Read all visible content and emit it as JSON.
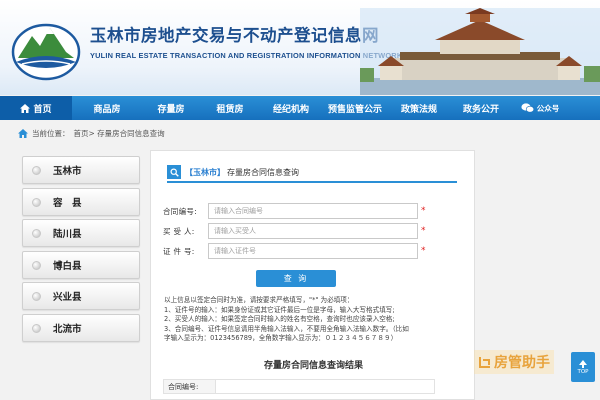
{
  "header": {
    "title_cn": "玉林市房地产交易与不动产登记信息网",
    "title_en": "YULIN REAL ESTATE TRANSACTION AND REGISTRATION INFORMATION NETWORK"
  },
  "nav": {
    "items": [
      {
        "label": "首页",
        "icon": "home-icon"
      },
      {
        "label": "商品房"
      },
      {
        "label": "存量房"
      },
      {
        "label": "租赁房"
      },
      {
        "label": "经纪机构"
      },
      {
        "label": "预售监管公示"
      },
      {
        "label": "政策法规"
      },
      {
        "label": "政务公开"
      },
      {
        "label": "公众号",
        "icon": "wechat-icon"
      }
    ]
  },
  "breadcrumb": {
    "prefix": "当前位置：",
    "path": "首页> 存量房合同信息查询",
    "icon": "home-icon"
  },
  "sidebar": {
    "items": [
      {
        "label": "玉林市"
      },
      {
        "label": "容　县"
      },
      {
        "label": "陆川县"
      },
      {
        "label": "博白县"
      },
      {
        "label": "兴业县"
      },
      {
        "label": "北流市"
      }
    ]
  },
  "panel": {
    "city": "【玉林市】",
    "title": "存量房合同信息查询",
    "icon": "search-icon",
    "form": [
      {
        "label": "合同编号:",
        "placeholder": "请输入合同编号"
      },
      {
        "label": "买 受 人:",
        "placeholder": "请输入买受人"
      },
      {
        "label": "证 件 号:",
        "placeholder": "请输入证件号"
      }
    ],
    "required_mark": "*",
    "query_label": "查 询",
    "notes": [
      "以上信息以签定合同时为准，请按要求严格填写，\"*\" 为必填项：",
      "1、证件号的输入：如果身份证或其它证件最后一位是字母，输入大写格式填写;",
      "2、买受人的输入：如果签定合同时输入的姓名有空格，查询时也应该录入空格;",
      "3、合同编号、证件号信息请用半角输入法输入，不要用全角输入法输入数字。（比如",
      "字输入显示为：0123456789，全角数字输入显示为：０１２３４５６７８９）"
    ],
    "result_title": "存量房合同信息查询结果",
    "result_rows": [
      {
        "label": "合同编号:"
      }
    ]
  },
  "watermark": {
    "text": "房管助手"
  },
  "top_button": {
    "label": "TOP"
  },
  "colors": {
    "nav_blue": "#1670bd",
    "accent_blue": "#2a8fd6",
    "title_blue": "#1d4f8f",
    "required_red": "#e02020"
  }
}
